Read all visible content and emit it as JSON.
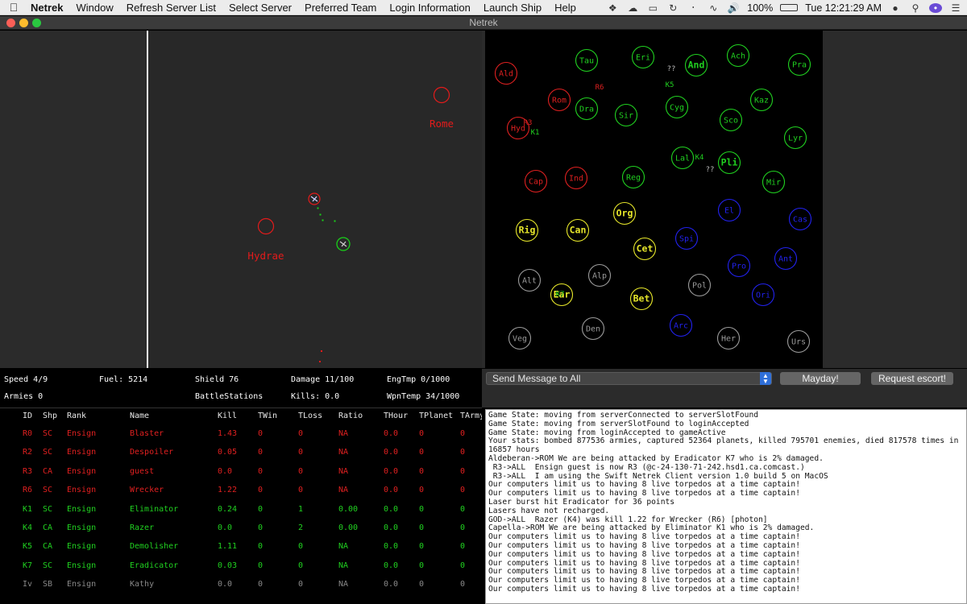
{
  "menubar": {
    "app_name": "Netrek",
    "items": [
      "Window",
      "Refresh Server List",
      "Select Server",
      "Preferred Team",
      "Login Information",
      "Launch Ship",
      "Help"
    ],
    "battery": "100%",
    "clock": "Tue 12:21:29 AM"
  },
  "window": {
    "title": "Netrek"
  },
  "tactical": {
    "planets": [
      {
        "name": "Rome",
        "color": "#e31b1b"
      },
      {
        "name": "Hydrae",
        "color": "#e31b1b"
      }
    ],
    "ship_labels": [
      "R6",
      "K1"
    ],
    "colors": {
      "background": "#282828",
      "enemy": "#e31b1b",
      "friendly": "#19d219",
      "torp": "#19d219",
      "border": "#f2f2f2"
    }
  },
  "galactic": {
    "planets": [
      {
        "name": "Ald",
        "color": "#dd2020",
        "bold": false
      },
      {
        "name": "Tau",
        "color": "#20d020",
        "bold": false
      },
      {
        "name": "Eri",
        "color": "#20d020",
        "bold": false
      },
      {
        "name": "And",
        "color": "#20d020",
        "bold": true
      },
      {
        "name": "Ach",
        "color": "#20d020",
        "bold": false
      },
      {
        "name": "Pra",
        "color": "#20d020",
        "bold": false
      },
      {
        "name": "Rom",
        "color": "#dd2020",
        "bold": false
      },
      {
        "name": "Dra",
        "color": "#20d020",
        "bold": false
      },
      {
        "name": "Sir",
        "color": "#20d020",
        "bold": false
      },
      {
        "name": "Cyg",
        "color": "#20d020",
        "bold": false
      },
      {
        "name": "Kaz",
        "color": "#20d020",
        "bold": false
      },
      {
        "name": "Sco",
        "color": "#20d020",
        "bold": false
      },
      {
        "name": "Hyd",
        "color": "#dd2020",
        "bold": false
      },
      {
        "name": "Lyr",
        "color": "#20d020",
        "bold": false
      },
      {
        "name": "Lal",
        "color": "#20d020",
        "bold": false
      },
      {
        "name": "Pli",
        "color": "#20d020",
        "bold": true
      },
      {
        "name": "Cap",
        "color": "#dd2020",
        "bold": false
      },
      {
        "name": "Ind",
        "color": "#dd2020",
        "bold": false
      },
      {
        "name": "Reg",
        "color": "#20d020",
        "bold": false
      },
      {
        "name": "Mir",
        "color": "#20d020",
        "bold": false
      },
      {
        "name": "El",
        "color": "#2222ee",
        "bold": false
      },
      {
        "name": "Cas",
        "color": "#2222ee",
        "bold": false
      },
      {
        "name": "Org",
        "color": "#e6e62a",
        "bold": true
      },
      {
        "name": "Rig",
        "color": "#e6e62a",
        "bold": true
      },
      {
        "name": "Can",
        "color": "#e6e62a",
        "bold": true
      },
      {
        "name": "Spi",
        "color": "#2222ee",
        "bold": false
      },
      {
        "name": "Cet",
        "color": "#e6e62a",
        "bold": true
      },
      {
        "name": "Ant",
        "color": "#2222ee",
        "bold": false
      },
      {
        "name": "Pro",
        "color": "#2222ee",
        "bold": false
      },
      {
        "name": "Alt",
        "color": "#9a9a9a",
        "bold": false
      },
      {
        "name": "Alp",
        "color": "#9a9a9a",
        "bold": false
      },
      {
        "name": "Pol",
        "color": "#9a9a9a",
        "bold": false
      },
      {
        "name": "Ori",
        "color": "#2222ee",
        "bold": false
      },
      {
        "name": "Ear",
        "color": "#e6e62a",
        "bold": true
      },
      {
        "name": "Bet",
        "color": "#e6e62a",
        "bold": true
      },
      {
        "name": "Den",
        "color": "#9a9a9a",
        "bold": false
      },
      {
        "name": "Arc",
        "color": "#2222ee",
        "bold": false
      },
      {
        "name": "Veg",
        "color": "#9a9a9a",
        "bold": false
      },
      {
        "name": "Her",
        "color": "#9a9a9a",
        "bold": false
      },
      {
        "name": "Urs",
        "color": "#9a9a9a",
        "bold": false
      }
    ],
    "markers": [
      {
        "text": "??",
        "color": "#bbbbbb"
      },
      {
        "text": "R6",
        "color": "#dd2020"
      },
      {
        "text": "K5",
        "color": "#20d020"
      },
      {
        "text": "R3",
        "color": "#dd2020"
      },
      {
        "text": "K1",
        "color": "#20d020"
      },
      {
        "text": "K4",
        "color": "#20d020"
      },
      {
        "text": "??",
        "color": "#bbbbbb"
      },
      {
        "text": "K7",
        "color": "#20d020"
      }
    ]
  },
  "status": {
    "speed": "Speed 4/9",
    "fuel": "Fuel: 5214",
    "shield": "Shield 76",
    "damage": "Damage 11/100",
    "engtemp": "EngTmp 0/1000",
    "armies": "Armies 0",
    "mode": "BattleStations",
    "kills": "Kills: 0.0",
    "wpntemp": "WpnTemp 34/1000"
  },
  "message": {
    "target": "Send Message to All",
    "mayday": "Mayday!",
    "escort": "Request escort!"
  },
  "players": {
    "headers": [
      "ID",
      "Shp",
      "Rank",
      "Name",
      "Kill",
      "TWin",
      "TLoss",
      "Ratio",
      "THour",
      "TPlanet",
      "TArmy"
    ],
    "rows": [
      {
        "cells": [
          "R0",
          "SC",
          "Ensign",
          "Blaster",
          "1.43",
          "0",
          "0",
          "NA",
          "0.0",
          "0",
          "0"
        ],
        "color": "#e02020"
      },
      {
        "cells": [
          "R2",
          "SC",
          "Ensign",
          "Despoiler",
          "0.05",
          "0",
          "0",
          "NA",
          "0.0",
          "0",
          "0"
        ],
        "color": "#e02020"
      },
      {
        "cells": [
          "R3",
          "CA",
          "Ensign",
          "guest",
          "0.0",
          "0",
          "0",
          "NA",
          "0.0",
          "0",
          "0"
        ],
        "color": "#e02020"
      },
      {
        "cells": [
          "R6",
          "SC",
          "Ensign",
          "Wrecker",
          "1.22",
          "0",
          "0",
          "NA",
          "0.0",
          "0",
          "0"
        ],
        "color": "#e02020"
      },
      {
        "cells": [
          "K1",
          "SC",
          "Ensign",
          "Eliminator",
          "0.24",
          "0",
          "1",
          "0.00",
          "0.0",
          "0",
          "0"
        ],
        "color": "#20d020"
      },
      {
        "cells": [
          "K4",
          "CA",
          "Ensign",
          "Razer",
          "0.0",
          "0",
          "2",
          "0.00",
          "0.0",
          "0",
          "0"
        ],
        "color": "#20d020"
      },
      {
        "cells": [
          "K5",
          "CA",
          "Ensign",
          "Demolisher",
          "1.11",
          "0",
          "0",
          "NA",
          "0.0",
          "0",
          "0"
        ],
        "color": "#20d020"
      },
      {
        "cells": [
          "K7",
          "SC",
          "Ensign",
          "Eradicator",
          "0.03",
          "0",
          "0",
          "NA",
          "0.0",
          "0",
          "0"
        ],
        "color": "#20d020"
      },
      {
        "cells": [
          "Iv",
          "SB",
          "Ensign",
          "Kathy",
          "0.0",
          "0",
          "0",
          "NA",
          "0.0",
          "0",
          "0"
        ],
        "color": "#888888"
      }
    ]
  },
  "log": [
    "Game State: moving from serverConnected to serverSlotFound",
    "Game State: moving from serverSlotFound to loginAccepted",
    "Game State: moving from loginAccepted to gameActive",
    "Your stats: bombed 877536 armies, captured 52364 planets, killed 795701 enemies, died 817578 times in 16857 hours",
    "Aldeberan->ROM We are being attacked by Eradicator K7 who is 2% damaged.",
    " R3->ALL  Ensign guest is now R3 (@c-24-130-71-242.hsd1.ca.comcast.)",
    " R3->ALL  I am using the Swift Netrek Client version 1.0 build 5 on MacOS",
    "Our computers limit us to having 8 live torpedos at a time captain!",
    "Our computers limit us to having 8 live torpedos at a time captain!",
    "Laser burst hit Eradicator for 36 points",
    "Lasers have not recharged.",
    "GOD->ALL  Razer (K4) was kill 1.22 for Wrecker (R6) [photon]",
    "Capella->ROM We are being attacked by Eliminator K1 who is 2% damaged.",
    "Our computers limit us to having 8 live torpedos at a time captain!",
    "Our computers limit us to having 8 live torpedos at a time captain!",
    "Our computers limit us to having 8 live torpedos at a time captain!",
    "Our computers limit us to having 8 live torpedos at a time captain!",
    "Our computers limit us to having 8 live torpedos at a time captain!",
    "Our computers limit us to having 8 live torpedos at a time captain!",
    "Our computers limit us to having 8 live torpedos at a time captain!"
  ]
}
